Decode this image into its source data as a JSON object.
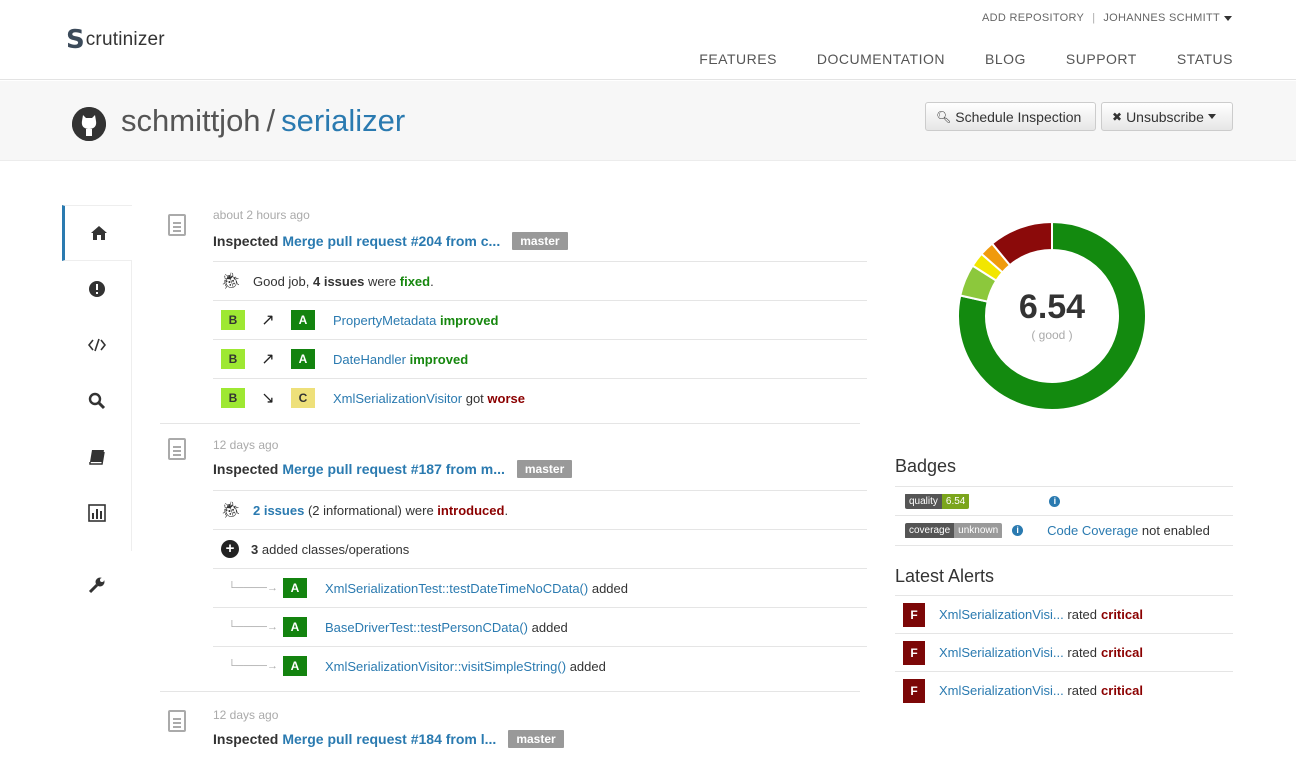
{
  "header": {
    "logo_mark": "S",
    "logo_text": "crutinizer",
    "account_links": [
      "ADD REPOSITORY",
      "JOHANNES SCHMITT"
    ],
    "nav": [
      "FEATURES",
      "DOCUMENTATION",
      "BLOG",
      "SUPPORT",
      "STATUS"
    ]
  },
  "repo": {
    "owner": "schmittjoh",
    "separator": "/",
    "name": "serializer",
    "schedule_label": "Schedule Inspection",
    "unsubscribe_label": "Unsubscribe"
  },
  "sidebar": [
    "home-icon",
    "alert-icon",
    "code-icon",
    "search-icon",
    "book-icon",
    "chart-icon",
    "wrench-icon"
  ],
  "events": [
    {
      "time": "about 2 hours ago",
      "prefix": "Inspected",
      "title": "Merge pull request #204 from c...",
      "branch": "master",
      "summary": {
        "pre": "Good job,",
        "count": "4 issues",
        "mid": "were",
        "status": "fixed",
        "post": "."
      },
      "changes": [
        {
          "from": "B",
          "arrow": "↗",
          "to": "A",
          "name": "PropertyMetadata",
          "verb": "improved"
        },
        {
          "from": "B",
          "arrow": "↗",
          "to": "A",
          "name": "DateHandler",
          "verb": "improved"
        },
        {
          "from": "B",
          "arrow": "↘",
          "to": "C",
          "name": "XmlSerializationVisitor",
          "mid": "got",
          "verb": "worse"
        }
      ]
    },
    {
      "time": "12 days ago",
      "prefix": "Inspected",
      "title": "Merge pull request #187 from m...",
      "branch": "master",
      "summary": {
        "count": "2 issues",
        "info": "(2 informational) were",
        "status": "introduced",
        "post": "."
      },
      "added": {
        "count": "3",
        "text": "added classes/operations"
      },
      "added_items": [
        {
          "grade": "A",
          "name": "XmlSerializationTest::testDateTimeNoCData()",
          "verb": "added"
        },
        {
          "grade": "A",
          "name": "BaseDriverTest::testPersonCData()",
          "verb": "added"
        },
        {
          "grade": "A",
          "name": "XmlSerializationVisitor::visitSimpleString()",
          "verb": "added"
        }
      ]
    },
    {
      "time": "12 days ago",
      "prefix": "Inspected",
      "title": "Merge pull request #184 from l...",
      "branch": "master"
    }
  ],
  "quality": {
    "score": "6.54",
    "label": "( good )",
    "distribution": [
      {
        "grade": "A",
        "fraction": 0.785,
        "color": "#138a0f"
      },
      {
        "grade": "B",
        "fraction": 0.055,
        "color": "#8cc83c"
      },
      {
        "grade": "C",
        "fraction": 0.025,
        "color": "#f2e600"
      },
      {
        "grade": "D",
        "fraction": 0.025,
        "color": "#f09a0c"
      },
      {
        "grade": "F",
        "fraction": 0.11,
        "color": "#8b0a0a"
      }
    ]
  },
  "badges": {
    "title": "Badges",
    "items": [
      {
        "left": "quality",
        "right": "6.54",
        "right_color": "#7ba51c"
      },
      {
        "left": "coverage",
        "right": "unknown",
        "right_color": "#9a9a9a",
        "link": "Code Coverage",
        "note": "not enabled"
      }
    ]
  },
  "alerts": {
    "title": "Latest Alerts",
    "items": [
      {
        "grade": "F",
        "name": "XmlSerializationVisi...",
        "text": "rated",
        "level": "critical"
      },
      {
        "grade": "F",
        "name": "XmlSerializationVisi...",
        "text": "rated",
        "level": "critical"
      },
      {
        "grade": "F",
        "name": "XmlSerializationVisi...",
        "text": "rated",
        "level": "critical"
      }
    ]
  }
}
